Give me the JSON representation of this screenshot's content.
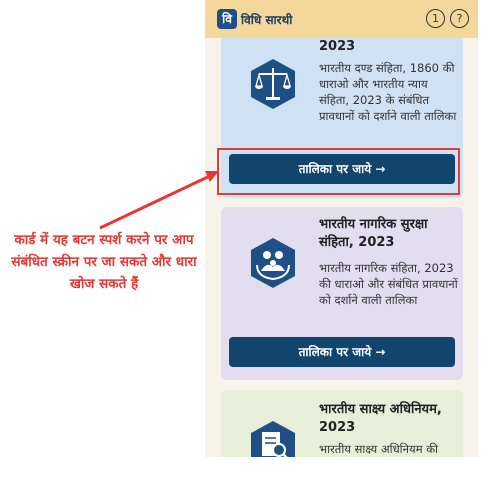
{
  "app": {
    "logo_letter": "वि",
    "title": "विधि सारथी",
    "info_icon": "1",
    "help_icon": "?"
  },
  "cards": [
    {
      "title": "2023",
      "desc": "भारतीय दण्ड संहिता, 1860 की धाराओ और भारतीय न्याय संहिता, 2023 के संबंधित प्रावधानों को दर्शाने वाली तालिका",
      "button": "तालिका पर जाये →",
      "icon": "scales-of-justice-icon"
    },
    {
      "title": "भारतीय नागरिक सुरक्षा संहिता, 2023",
      "desc": "भारतीय नागरिक संहिता, 2023 की धाराओ और संबंधित प्रावधानों को दर्शाने वाली तालिका",
      "button": "तालिका पर जाये →",
      "icon": "family-protection-icon"
    },
    {
      "title": "भारतीय साक्ष्य अधिनियम, 2023",
      "desc": "भारतीय साक्ष्य अधिनियम की",
      "icon": "evidence-document-icon"
    }
  ],
  "annotation": {
    "text": "कार्ड में यह बटन स्पर्श करने पर आप संबंधित स्क्रीन पर जा सकते और धारा खोज सकते हैं"
  },
  "colors": {
    "appbar": "#f3d79b",
    "button": "#12456e",
    "highlight": "#e53935"
  }
}
